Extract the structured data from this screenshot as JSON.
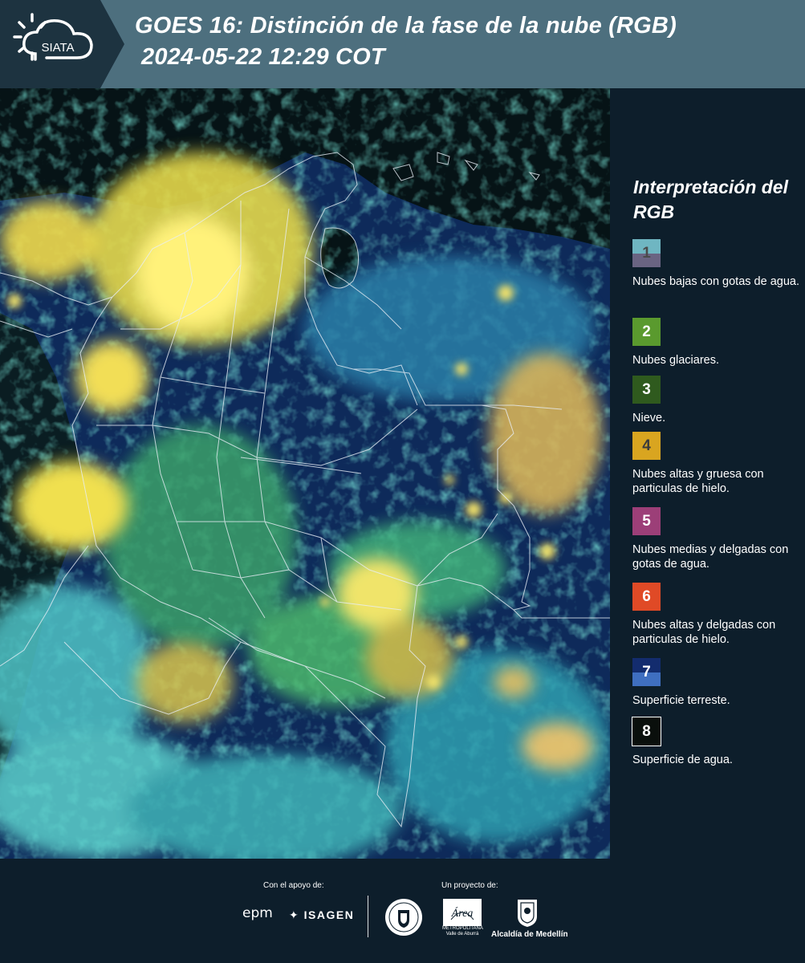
{
  "header": {
    "logo_text": "SIATA",
    "title_line1": "GOES 16: Distinción de la fase de la nube (RGB)",
    "title_line2": "2024-05-22 12:29 COT"
  },
  "legend": {
    "title": "Interpretación del RGB",
    "items": [
      {
        "number": "1",
        "label": "Nubes bajas con gotas de agua.",
        "color_top": "#6fb6c2",
        "color_bottom": "#6a6482",
        "text_color": "#4a4a4a"
      },
      {
        "number": "2",
        "label": "Nubes glaciares.",
        "color_top": "#5a9a2e",
        "color_bottom": "#5a9a2e",
        "text_color": "#ffffff"
      },
      {
        "number": "3",
        "label": "Nieve.",
        "color_top": "#2f5a1e",
        "color_bottom": "#2f5a1e",
        "text_color": "#ffffff"
      },
      {
        "number": "4",
        "label": "Nubes altas y gruesa con particulas de hielo.",
        "color_top": "#d9a520",
        "color_bottom": "#d9a520",
        "text_color": "#3c3c3c"
      },
      {
        "number": "5",
        "label": "Nubes medias y delgadas con gotas de agua.",
        "color_top": "#9c3f78",
        "color_bottom": "#9c3f78",
        "text_color": "#ffffff"
      },
      {
        "number": "6",
        "label": "Nubes altas y delgadas con particulas de hielo.",
        "color_top": "#e04a26",
        "color_bottom": "#e04a26",
        "text_color": "#ffffff"
      },
      {
        "number": "7",
        "label": "Superficie terreste.",
        "color_top": "#132c6e",
        "color_bottom": "#3f6fc0",
        "text_color": "#ffffff"
      },
      {
        "number": "8",
        "label": "Superficie de agua.",
        "color_top": "#0a0f0c",
        "color_bottom": "#0a0f0c",
        "text_color": "#ffffff",
        "border": "#ffffff"
      }
    ]
  },
  "footer": {
    "support_label": "Con el apoyo de:",
    "project_label": "Un proyecto de:",
    "epm_text": "epm",
    "isagen_text": "ISAGEN",
    "area_text": "Área",
    "area_subtext": "METROPOLITANA Valle de Aburrá",
    "alcaldia_text": "Alcaldía de Medellín"
  }
}
